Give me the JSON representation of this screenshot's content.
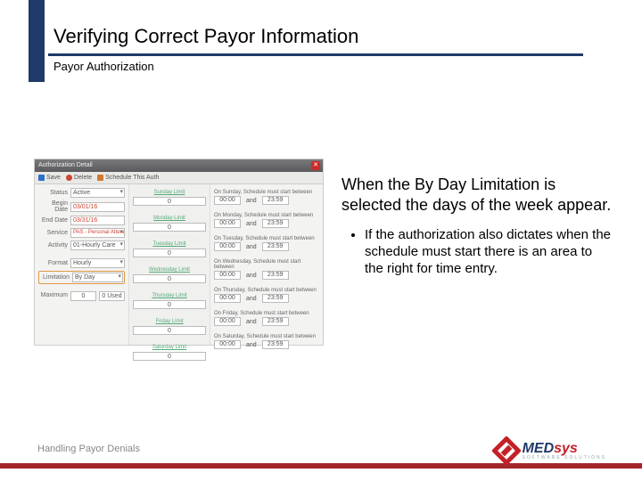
{
  "header": {
    "title": "Verifying Correct Payor Information",
    "subtitle": "Payor Authorization"
  },
  "screenshot": {
    "window_title": "Authorization Detail",
    "toolbar": {
      "save": "Save",
      "delete": "Delete",
      "schedule": "Schedule This Auth"
    },
    "fields": {
      "status": {
        "label": "Status",
        "value": "Active"
      },
      "begin_date": {
        "label": "Begin Date",
        "value": "03/01/16"
      },
      "end_date": {
        "label": "End Date",
        "value": "03/31/16"
      },
      "service": {
        "label": "Service",
        "value": "PAS - Personal Attendant Serv"
      },
      "activity": {
        "label": "Activity",
        "value": "01-Hourly Care"
      },
      "format": {
        "label": "Format",
        "value": "Hourly"
      },
      "limitation": {
        "label": "Limitation",
        "value": "By Day"
      },
      "maximum": {
        "label": "Maximum",
        "values": [
          "0",
          "0 Used"
        ]
      }
    },
    "days": [
      {
        "name": "Sunday Limit",
        "value": "0",
        "sched_label": "On Sunday, Schedule must start between"
      },
      {
        "name": "Monday Limit",
        "value": "0",
        "sched_label": "On Monday, Schedule must start between"
      },
      {
        "name": "Tuesday Limit",
        "value": "0",
        "sched_label": "On Tuesday, Schedule must start between"
      },
      {
        "name": "Wednesday Limit",
        "value": "0",
        "sched_label": "On Wednesday, Schedule must start between"
      },
      {
        "name": "Thursday Limit",
        "value": "0",
        "sched_label": "On Thursday, Schedule must start between"
      },
      {
        "name": "Friday Limit",
        "value": "0",
        "sched_label": "On Friday, Schedule must start between"
      },
      {
        "name": "Saturday Limit",
        "value": "0",
        "sched_label": "On Saturday, Schedule must start between"
      }
    ],
    "time_from": "00:00",
    "time_join": "and",
    "time_to": "23:59"
  },
  "content": {
    "lead": "When the By Day Limitation is selected the days of the week appear.",
    "bullet1": "If the authorization also dictates when the schedule must start there is an area to the right for time entry."
  },
  "footer": {
    "label": "Handling Payor Denials"
  },
  "logo": {
    "brand_left": "MED",
    "brand_right": "sys",
    "tag": "SOFTWARE SOLUTIONS"
  }
}
